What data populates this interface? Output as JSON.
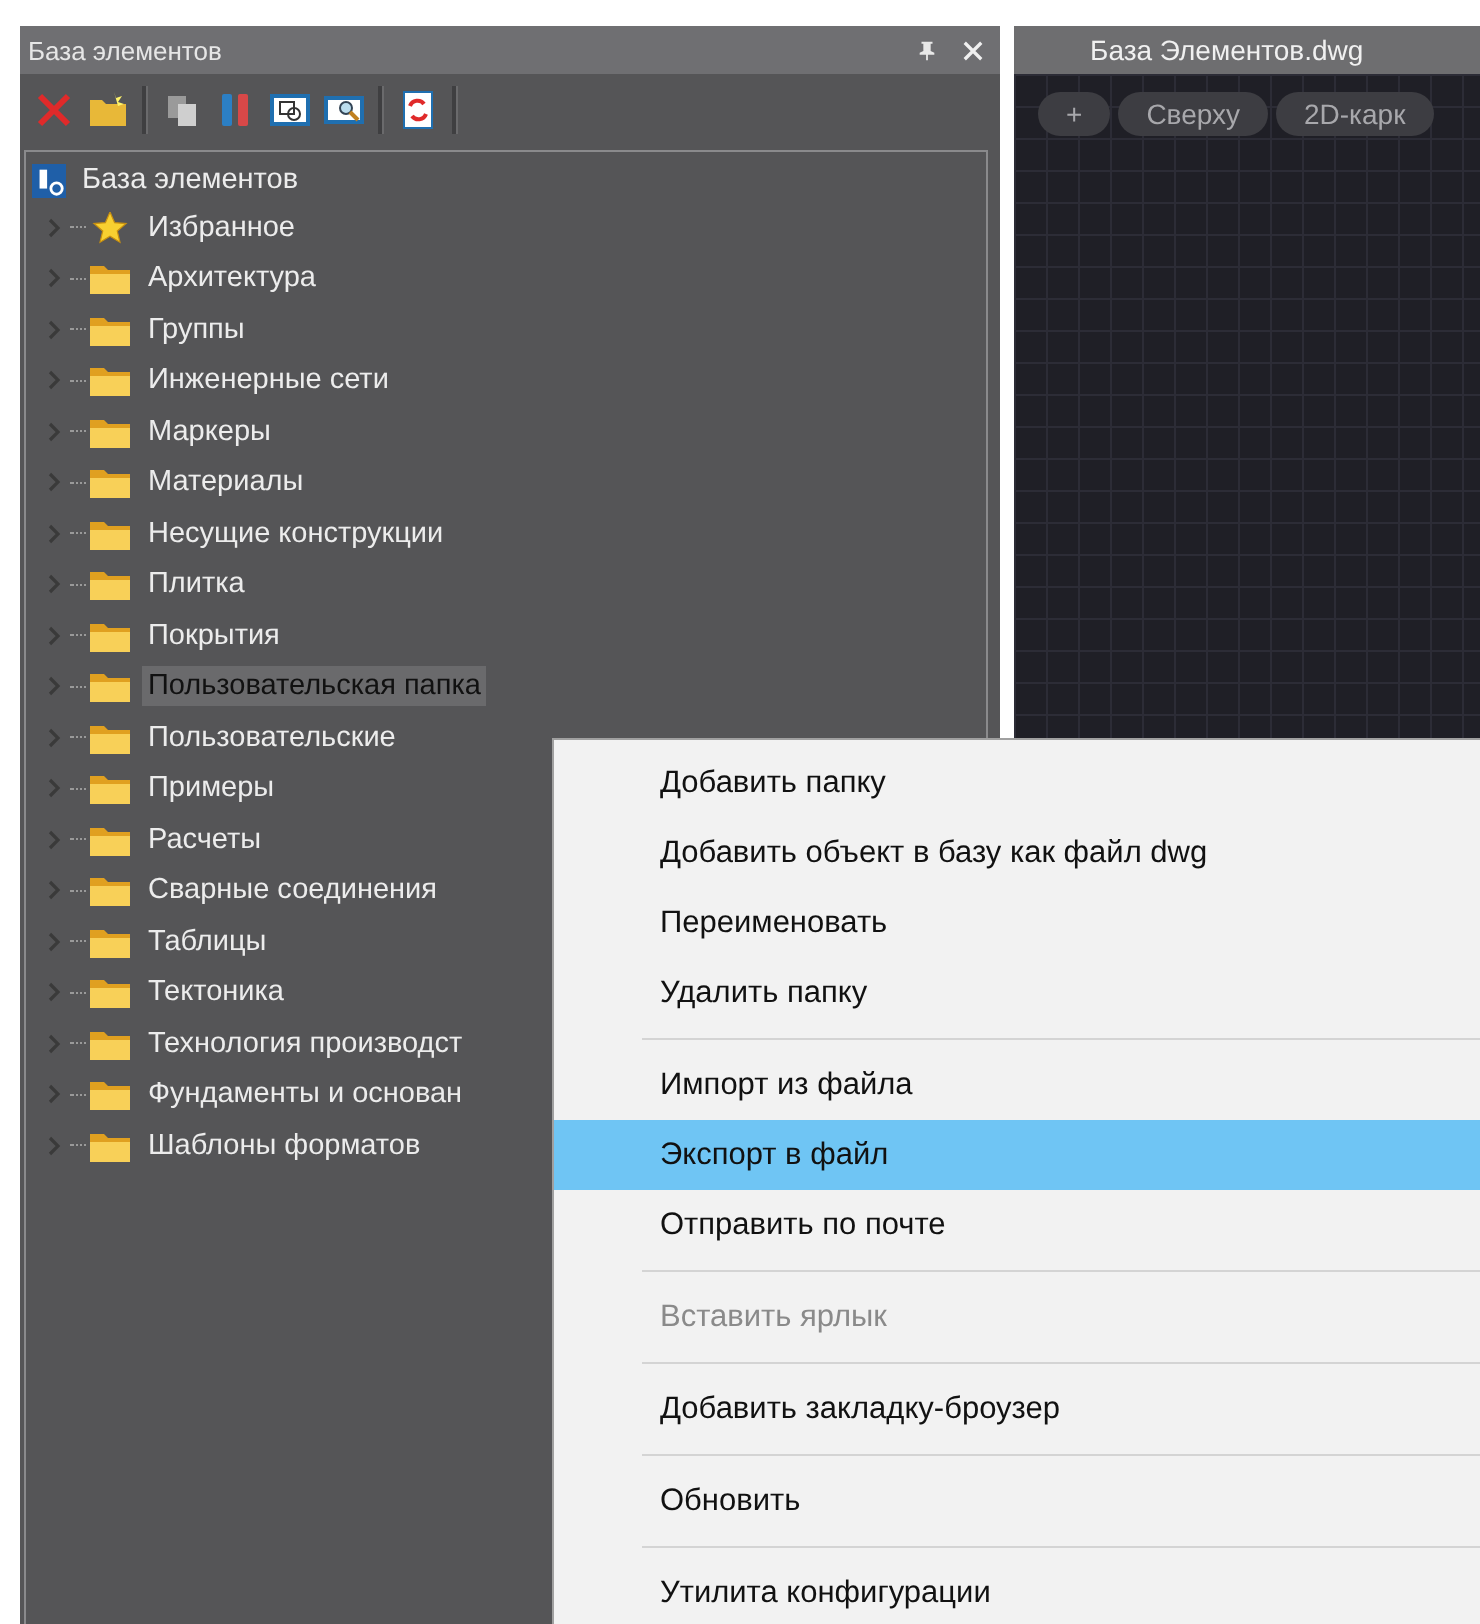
{
  "panel": {
    "title": "База элементов"
  },
  "tree": {
    "label": "База элементов",
    "children": [
      {
        "label": "Избранное",
        "kind": "favorite",
        "expanded": false,
        "selected": false
      },
      {
        "label": "Архитектура",
        "kind": "folder",
        "expanded": false,
        "selected": false
      },
      {
        "label": "Группы",
        "kind": "folder",
        "expanded": false,
        "selected": false
      },
      {
        "label": "Инженерные сети",
        "kind": "folder",
        "expanded": false,
        "selected": false
      },
      {
        "label": "Маркеры",
        "kind": "folder",
        "expanded": false,
        "selected": false
      },
      {
        "label": "Материалы",
        "kind": "folder",
        "expanded": false,
        "selected": false
      },
      {
        "label": "Несущие конструкции",
        "kind": "folder",
        "expanded": false,
        "selected": false
      },
      {
        "label": "Плитка",
        "kind": "folder",
        "expanded": false,
        "selected": false
      },
      {
        "label": "Покрытия",
        "kind": "folder",
        "expanded": false,
        "selected": false
      },
      {
        "label": "Пользовательская папка",
        "kind": "folder",
        "expanded": false,
        "selected": true
      },
      {
        "label": "Пользовательские",
        "kind": "folder",
        "expanded": false,
        "selected": false
      },
      {
        "label": "Примеры",
        "kind": "folder",
        "expanded": false,
        "selected": false
      },
      {
        "label": "Расчеты",
        "kind": "folder",
        "expanded": false,
        "selected": false
      },
      {
        "label": "Сварные соединения",
        "kind": "folder",
        "expanded": false,
        "selected": false
      },
      {
        "label": "Таблицы",
        "kind": "folder",
        "expanded": false,
        "selected": false
      },
      {
        "label": "Тектоника",
        "kind": "folder",
        "expanded": false,
        "selected": false
      },
      {
        "label": "Технология производст",
        "kind": "folder",
        "expanded": false,
        "selected": false
      },
      {
        "label": "Фундаменты и основан",
        "kind": "folder",
        "expanded": false,
        "selected": false
      },
      {
        "label": "Шаблоны форматов",
        "kind": "folder",
        "expanded": false,
        "selected": false
      }
    ]
  },
  "document": {
    "tab": "База Элементов.dwg",
    "view_buttons": [
      "+",
      "Сверху",
      "2D-карк"
    ]
  },
  "context_menu": [
    {
      "kind": "item",
      "label": "Добавить папку",
      "disabled": false,
      "selected": false
    },
    {
      "kind": "item",
      "label": "Добавить объект в базу как файл dwg",
      "disabled": false,
      "selected": false
    },
    {
      "kind": "item",
      "label": "Переименовать",
      "disabled": false,
      "selected": false
    },
    {
      "kind": "item",
      "label": "Удалить папку",
      "disabled": false,
      "selected": false
    },
    {
      "kind": "separator"
    },
    {
      "kind": "item",
      "label": "Импорт из файла",
      "disabled": false,
      "selected": false
    },
    {
      "kind": "item",
      "label": "Экспорт в файл",
      "disabled": false,
      "selected": true
    },
    {
      "kind": "item",
      "label": "Отправить по почте",
      "disabled": false,
      "selected": false
    },
    {
      "kind": "separator"
    },
    {
      "kind": "item",
      "label": "Вставить ярлык",
      "disabled": true,
      "selected": false
    },
    {
      "kind": "separator"
    },
    {
      "kind": "item",
      "label": "Добавить закладку-броузер",
      "disabled": false,
      "selected": false
    },
    {
      "kind": "separator"
    },
    {
      "kind": "item",
      "label": "Обновить",
      "disabled": false,
      "selected": false
    },
    {
      "kind": "separator"
    },
    {
      "kind": "item",
      "label": "Утилита конфигурации",
      "disabled": false,
      "selected": false
    }
  ]
}
